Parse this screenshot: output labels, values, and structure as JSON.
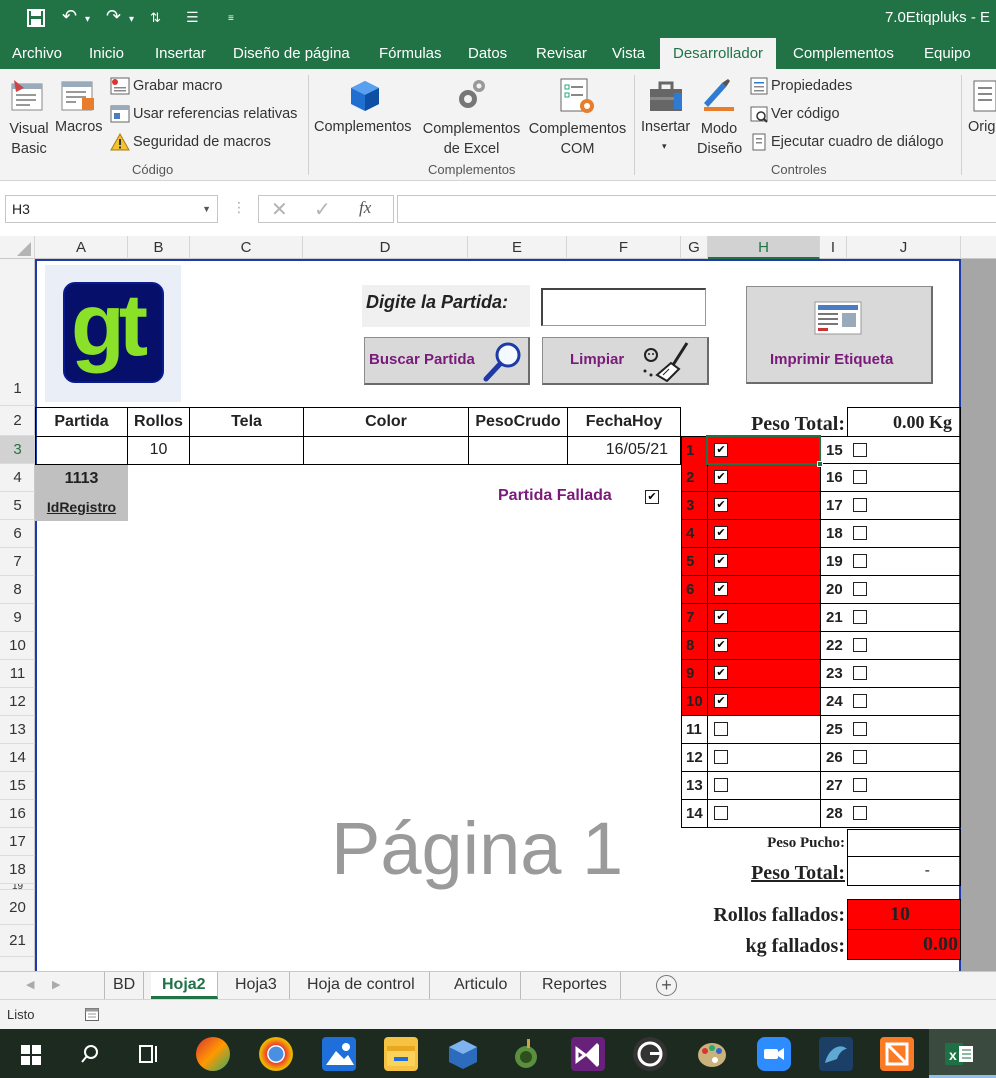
{
  "window": {
    "title": "7.0Etiqpluks - E"
  },
  "ribbon_tabs": [
    "Archivo",
    "Inicio",
    "Insertar",
    "Diseño de página",
    "Fórmulas",
    "Datos",
    "Revisar",
    "Vista",
    "Desarrollador",
    "Complementos",
    "Equipo"
  ],
  "active_tab": "Desarrollador",
  "ribbon": {
    "codigo": {
      "visual_basic": "Visual Basic",
      "macros": "Macros",
      "grabar_macro": "Grabar macro",
      "usar_referencias": "Usar referencias relativas",
      "seguridad": "Seguridad de macros",
      "label": "Código"
    },
    "complementos": {
      "complementos": "Complementos",
      "complementos_excel_1": "Complementos",
      "complementos_excel_2": "de Excel",
      "complementos_com_1": "Complementos",
      "complementos_com_2": "COM",
      "label": "Complementos"
    },
    "controles": {
      "insertar": "Insertar",
      "modo_diseno_1": "Modo",
      "modo_diseno_2": "Diseño",
      "propiedades": "Propiedades",
      "ver_codigo": "Ver código",
      "ejecutar": "Ejecutar cuadro de diálogo",
      "label": "Controles"
    },
    "origen": "Orig"
  },
  "formula_bar": {
    "name_box": "H3",
    "fx": "fx",
    "formula": ""
  },
  "columns": [
    "A",
    "B",
    "C",
    "D",
    "E",
    "F",
    "G",
    "H",
    "I",
    "J"
  ],
  "rows": [
    "1",
    "2",
    "3",
    "4",
    "5",
    "6",
    "7",
    "8",
    "9",
    "10",
    "11",
    "12",
    "13",
    "14",
    "15",
    "16",
    "17",
    "18",
    "19",
    "20",
    "21"
  ],
  "sheet": {
    "logo_text": "gt",
    "digite_label": "Digite la Partida:",
    "partida_input": "",
    "buscar_btn": "Buscar Partida",
    "limpiar_btn": "Limpiar",
    "imprimir_btn": "Imprimir Etiqueta",
    "table_headers": [
      "Partida",
      "Rollos",
      "Tela",
      "Color",
      "PesoCrudo",
      "FechaHoy"
    ],
    "table_row": [
      "",
      "10",
      "",
      "",
      "",
      "16/05/21"
    ],
    "id_value": "1113",
    "id_label": "IdRegistro",
    "partida_fallada": "Partida Fallada",
    "watermark": "Página 1",
    "peso_total_label": "Peso Total:",
    "peso_total_value": "0.00 Kg",
    "rolls_left": [
      {
        "n": "1",
        "checked": true
      },
      {
        "n": "2",
        "checked": true
      },
      {
        "n": "3",
        "checked": true
      },
      {
        "n": "4",
        "checked": true
      },
      {
        "n": "5",
        "checked": true
      },
      {
        "n": "6",
        "checked": true
      },
      {
        "n": "7",
        "checked": true
      },
      {
        "n": "8",
        "checked": true
      },
      {
        "n": "9",
        "checked": true
      },
      {
        "n": "10",
        "checked": true
      },
      {
        "n": "11",
        "checked": false
      },
      {
        "n": "12",
        "checked": false
      },
      {
        "n": "13",
        "checked": false
      },
      {
        "n": "14",
        "checked": false
      }
    ],
    "rolls_right": [
      {
        "n": "15"
      },
      {
        "n": "16"
      },
      {
        "n": "17"
      },
      {
        "n": "18"
      },
      {
        "n": "19"
      },
      {
        "n": "20"
      },
      {
        "n": "21"
      },
      {
        "n": "22"
      },
      {
        "n": "23"
      },
      {
        "n": "24"
      },
      {
        "n": "25"
      },
      {
        "n": "26"
      },
      {
        "n": "27"
      },
      {
        "n": "28"
      }
    ],
    "peso_pucho_label": "Peso Pucho:",
    "peso_pucho_value": "",
    "peso_total2_label": "Peso Total:",
    "peso_total2_value": "-",
    "rollos_fallados_label": "Rollos fallados:",
    "rollos_fallados_value": "10",
    "kg_fallados_label": "kg fallados:",
    "kg_fallados_value": "0.00"
  },
  "sheet_tabs": [
    "BD",
    "Hoja2",
    "Hoja3",
    "Hoja de control",
    "Articulo",
    "Reportes"
  ],
  "active_sheet": "Hoja2",
  "status": {
    "text": "Listo"
  },
  "colors": {
    "excel_green": "#217346",
    "red_fill": "#ff0000",
    "button_text": "#7a1a7a",
    "border_blue": "#1f3aa6"
  }
}
